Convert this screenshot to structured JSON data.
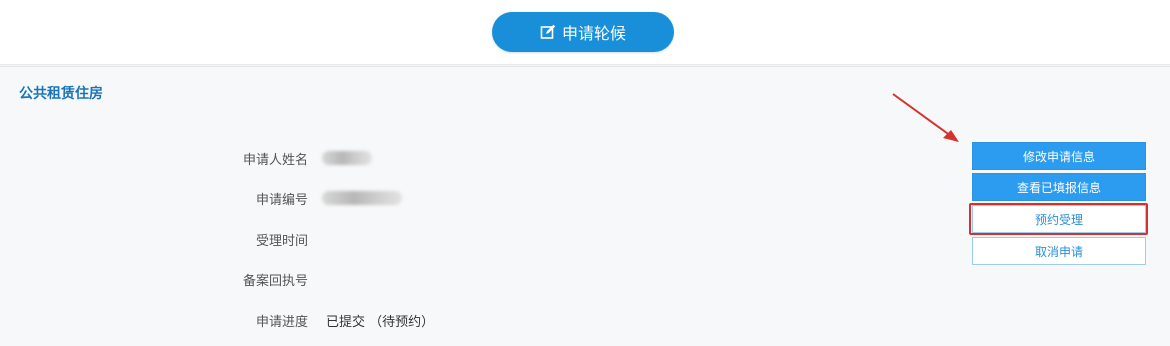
{
  "header": {
    "apply_button_label": "申请轮候",
    "apply_icon": "edit-icon"
  },
  "section": {
    "title": "公共租赁住房"
  },
  "info": {
    "name_label": "申请人姓名",
    "number_label": "申请编号",
    "time_label": "受理时间",
    "receipt_label": "备案回执号",
    "progress_label": "申请进度",
    "progress_value": "已提交 （待预约）"
  },
  "actions": {
    "modify": "修改申请信息",
    "view": "查看已填报信息",
    "appointment": "预约受理",
    "cancel": "取消申请"
  },
  "colors": {
    "primary": "#1a8fd9",
    "highlight": "#d7312f"
  }
}
